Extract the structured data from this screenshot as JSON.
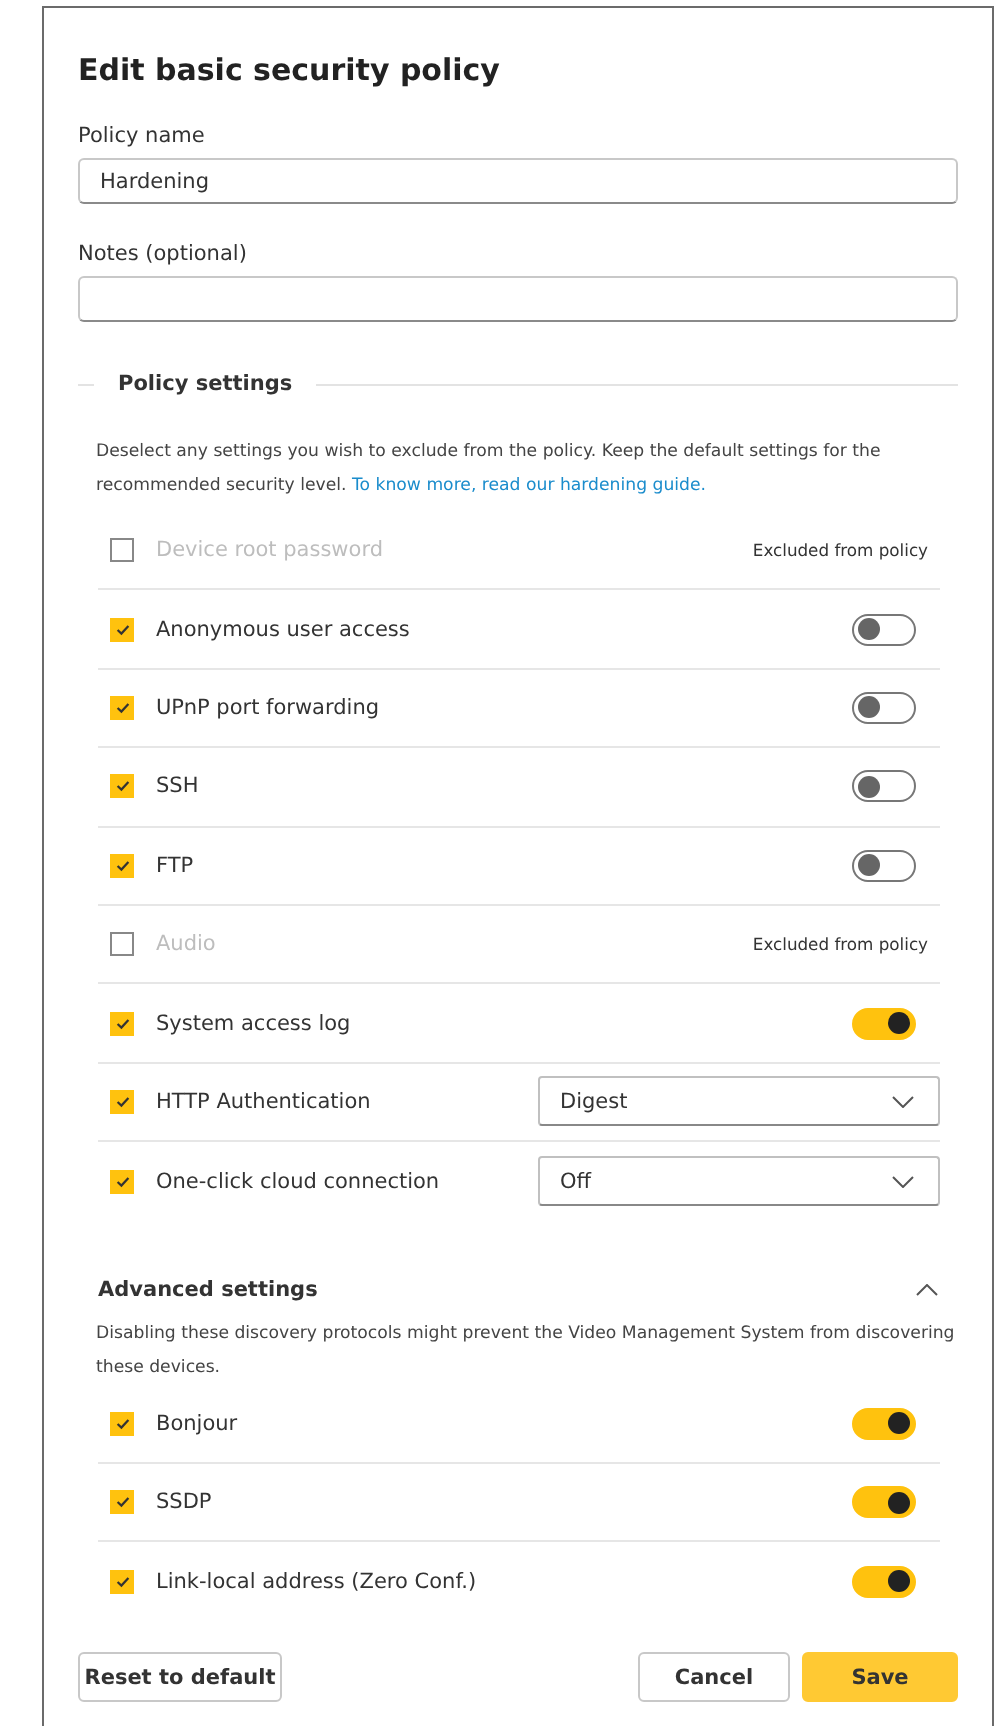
{
  "dialog": {
    "title": "Edit basic security policy"
  },
  "policy_name": {
    "label": "Policy name",
    "value": "Hardening"
  },
  "notes": {
    "label": "Notes (optional)"
  },
  "policy_settings": {
    "legend": "Policy settings",
    "description": "Deselect any settings you wish to exclude from the policy. Keep the default settings for the recommended security level.",
    "link": "To know more, read our hardening guide.",
    "items": [
      {
        "label": "Device root password",
        "checked": false,
        "note": "Excluded from policy"
      },
      {
        "label": "Anonymous user access",
        "checked": true,
        "kind": "toggle",
        "on": false
      },
      {
        "label": "UPnP port forwarding",
        "checked": true,
        "kind": "toggle",
        "on": false
      },
      {
        "label": "SSH",
        "checked": true,
        "kind": "toggle",
        "on": false
      },
      {
        "label": "FTP",
        "checked": true,
        "kind": "toggle",
        "on": false
      },
      {
        "label": "Audio",
        "checked": false,
        "note": "Excluded from policy"
      },
      {
        "label": "System access log",
        "checked": true,
        "kind": "toggle",
        "on": true
      },
      {
        "label": "HTTP Authentication",
        "checked": true,
        "kind": "select",
        "value": "Digest"
      },
      {
        "label": "One-click cloud connection",
        "checked": true,
        "kind": "select",
        "value": "Off"
      }
    ]
  },
  "advanced_settings": {
    "title": "Advanced settings",
    "expanded": true,
    "description": "Disabling these discovery protocols might prevent the Video Management System from discovering these devices.",
    "items": [
      {
        "label": "Bonjour",
        "checked": true,
        "kind": "toggle",
        "on": true
      },
      {
        "label": "SSDP",
        "checked": true,
        "kind": "toggle",
        "on": true
      },
      {
        "label": "Link-local address (Zero Conf.)",
        "checked": true,
        "kind": "toggle",
        "on": true
      }
    ]
  },
  "buttons": {
    "reset": "Reset to default",
    "cancel": "Cancel",
    "save": "Save"
  }
}
